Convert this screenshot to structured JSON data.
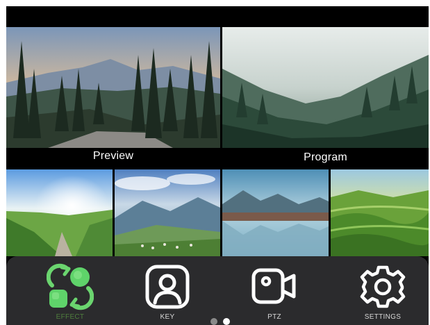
{
  "monitors": {
    "preview_label": "Preview",
    "program_label": "Program"
  },
  "dock": {
    "items": [
      {
        "label": "EFFECT",
        "icon": "effect-icon",
        "active": true
      },
      {
        "label": "KEY",
        "icon": "key-portrait-icon",
        "active": false
      },
      {
        "label": "PTZ",
        "icon": "ptz-camera-icon",
        "active": false
      },
      {
        "label": "SETTINGS",
        "icon": "gear-icon",
        "active": false
      }
    ],
    "page_indicator": {
      "pages": 2,
      "current": 2
    }
  },
  "colors": {
    "accent_green": "#5fd36a",
    "active_label": "#4f7f3e",
    "dock_bg": "#2b2b2d"
  }
}
